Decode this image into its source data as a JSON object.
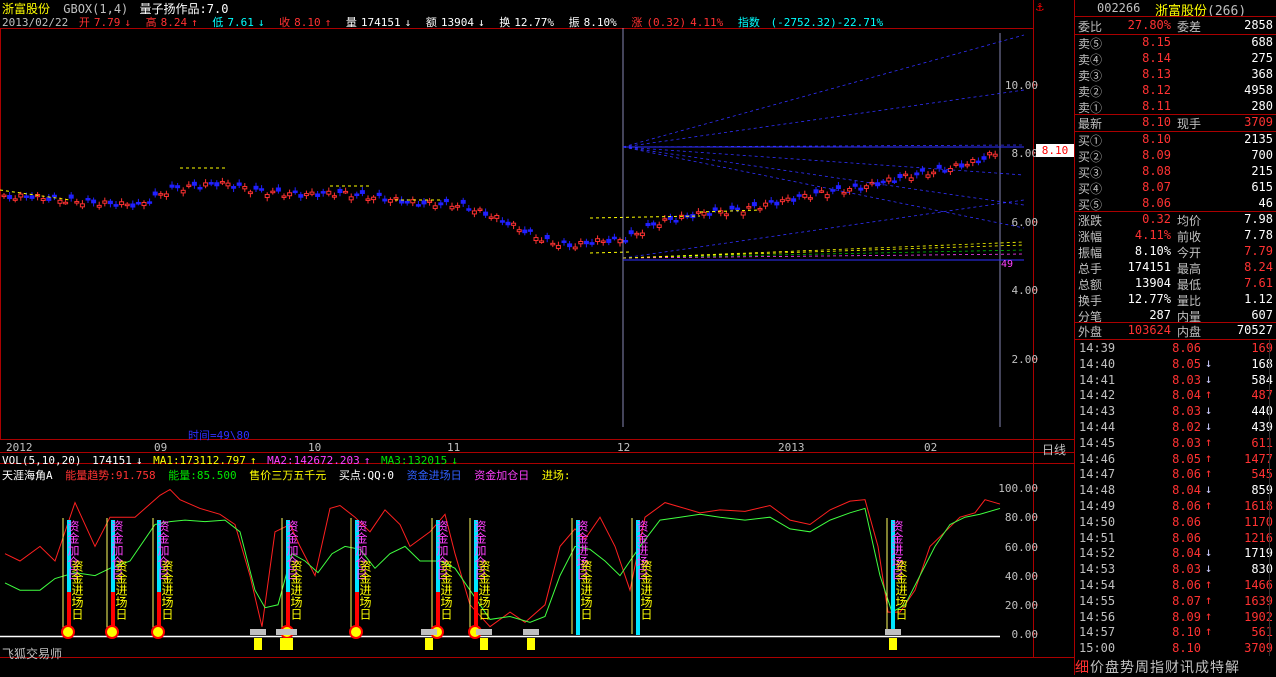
{
  "header": {
    "stock_name": "浙富股份",
    "indicator": "GBOX(1,4)",
    "author": "量子扬作品:7.0"
  },
  "info_bar": {
    "date": "2013/02/22",
    "open_label": "开",
    "open": "7.79",
    "high_label": "高",
    "high": "8.24",
    "low_label": "低",
    "low": "7.61",
    "close_label": "收",
    "close": "8.10",
    "vol_label": "量",
    "vol": "174151",
    "amt_label": "额",
    "amt": "13904",
    "turn_label": "换",
    "turn": "12.77%",
    "amp_label": "振",
    "amp": "8.10%",
    "chg_label": "涨",
    "chg": "(0.32)",
    "chg_pct": "4.11%",
    "index_label": "指数",
    "index": "(-2752.32)-22.71%"
  },
  "price_axis": [
    "10.00",
    "8.00",
    "6.00",
    "4.00",
    "2.00"
  ],
  "current_price_tag": "8.10",
  "time_axis": [
    "2012",
    "09",
    "10",
    "11",
    "12",
    "2013",
    "02"
  ],
  "period_label": "日线",
  "draw_label": "时间=49\\80",
  "candle_count_label": "49",
  "vol_legend": {
    "vol": "VOL(5,10,20)",
    "vol_val": "174151",
    "ma1": "MA1:173112.797",
    "ma2": "MA2:142672.203",
    "ma3": "MA3:132015"
  },
  "ind_legend": {
    "name": "天涯海角A",
    "energy_trend": "能量趋势:91.758",
    "energy": "能量:85.500",
    "sell": "售价三万五千元",
    "buy": "买点:QQ:0",
    "enter": "资金进场日",
    "add": "资金加仓日",
    "in": "进场:"
  },
  "ind_axis": [
    "100.00",
    "80.00",
    "60.00",
    "40.00",
    "20.00",
    "0.00"
  ],
  "watermark": "飞狐交易师",
  "signals": {
    "enter_text": "资金进场日",
    "add_text": "资金加仓日"
  },
  "panel": {
    "code": "002266",
    "name": "浙富股份",
    "count": "(266)",
    "weibi_label": "委比",
    "weibi": "27.80%",
    "weicha_label": "委差",
    "weicha": "2858",
    "sells": [
      {
        "label": "卖⑤",
        "price": "8.15",
        "vol": "688"
      },
      {
        "label": "卖④",
        "price": "8.14",
        "vol": "275"
      },
      {
        "label": "卖③",
        "price": "8.13",
        "vol": "368"
      },
      {
        "label": "卖②",
        "price": "8.12",
        "vol": "4958"
      },
      {
        "label": "卖①",
        "price": "8.11",
        "vol": "280"
      }
    ],
    "latest_label": "最新",
    "latest": "8.10",
    "now_label": "现手",
    "now": "3709",
    "buys": [
      {
        "label": "买①",
        "price": "8.10",
        "vol": "2135"
      },
      {
        "label": "买②",
        "price": "8.09",
        "vol": "700"
      },
      {
        "label": "买③",
        "price": "8.08",
        "vol": "215"
      },
      {
        "label": "买④",
        "price": "8.07",
        "vol": "615"
      },
      {
        "label": "买⑤",
        "price": "8.06",
        "vol": "46"
      }
    ],
    "stats": [
      {
        "l1": "涨跌",
        "v1": "0.32",
        "c1": "red",
        "l2": "均价",
        "v2": "7.98",
        "c2": "wht"
      },
      {
        "l1": "涨幅",
        "v1": "4.11%",
        "c1": "red",
        "l2": "前收",
        "v2": "7.78",
        "c2": "wht"
      },
      {
        "l1": "振幅",
        "v1": "8.10%",
        "c1": "wht",
        "l2": "今开",
        "v2": "7.79",
        "c2": "red"
      },
      {
        "l1": "总手",
        "v1": "174151",
        "c1": "wht",
        "l2": "最高",
        "v2": "8.24",
        "c2": "red"
      },
      {
        "l1": "总额",
        "v1": "13904",
        "c1": "wht",
        "l2": "最低",
        "v2": "7.61",
        "c2": "red"
      },
      {
        "l1": "换手",
        "v1": "12.77%",
        "c1": "wht",
        "l2": "量比",
        "v2": "1.12",
        "c2": "wht"
      },
      {
        "l1": "分笔",
        "v1": "287",
        "c1": "wht",
        "l2": "内量",
        "v2": "607",
        "c2": "wht"
      }
    ],
    "outer_label": "外盘",
    "outer": "103624",
    "inner_label": "内盘",
    "inner": "70527",
    "trades": [
      {
        "t": "14:39",
        "p": "8.06",
        "d": "",
        "v": "169",
        "pc": "red",
        "vc": "red"
      },
      {
        "t": "14:40",
        "p": "8.05",
        "d": "down",
        "v": "168",
        "pc": "red",
        "vc": "wht"
      },
      {
        "t": "14:41",
        "p": "8.03",
        "d": "down",
        "v": "584",
        "pc": "red",
        "vc": "wht"
      },
      {
        "t": "14:42",
        "p": "8.04",
        "d": "up",
        "v": "487",
        "pc": "red",
        "vc": "red"
      },
      {
        "t": "14:43",
        "p": "8.03",
        "d": "down",
        "v": "440",
        "pc": "red",
        "vc": "wht"
      },
      {
        "t": "14:44",
        "p": "8.02",
        "d": "down",
        "v": "439",
        "pc": "red",
        "vc": "wht"
      },
      {
        "t": "14:45",
        "p": "8.03",
        "d": "up",
        "v": "611",
        "pc": "red",
        "vc": "red"
      },
      {
        "t": "14:46",
        "p": "8.05",
        "d": "up",
        "v": "1477",
        "pc": "red",
        "vc": "red"
      },
      {
        "t": "14:47",
        "p": "8.06",
        "d": "up",
        "v": "545",
        "pc": "red",
        "vc": "red"
      },
      {
        "t": "14:48",
        "p": "8.04",
        "d": "down",
        "v": "859",
        "pc": "red",
        "vc": "wht"
      },
      {
        "t": "14:49",
        "p": "8.06",
        "d": "up",
        "v": "1618",
        "pc": "red",
        "vc": "red"
      },
      {
        "t": "14:50",
        "p": "8.06",
        "d": "",
        "v": "1170",
        "pc": "red",
        "vc": "red"
      },
      {
        "t": "14:51",
        "p": "8.06",
        "d": "",
        "v": "1216",
        "pc": "red",
        "vc": "red"
      },
      {
        "t": "14:52",
        "p": "8.04",
        "d": "down",
        "v": "1719",
        "pc": "red",
        "vc": "wht"
      },
      {
        "t": "14:53",
        "p": "8.03",
        "d": "down",
        "v": "830",
        "pc": "red",
        "vc": "wht"
      },
      {
        "t": "14:54",
        "p": "8.06",
        "d": "up",
        "v": "1466",
        "pc": "red",
        "vc": "red"
      },
      {
        "t": "14:55",
        "p": "8.07",
        "d": "up",
        "v": "1639",
        "pc": "red",
        "vc": "red"
      },
      {
        "t": "14:56",
        "p": "8.09",
        "d": "up",
        "v": "1902",
        "pc": "red",
        "vc": "red"
      },
      {
        "t": "14:57",
        "p": "8.10",
        "d": "up",
        "v": "561",
        "pc": "red",
        "vc": "red"
      },
      {
        "t": "15:00",
        "p": "8.10",
        "d": "",
        "v": "3709",
        "pc": "red",
        "vc": "red"
      }
    ],
    "tabs": [
      "细",
      "价",
      "盘",
      "势",
      "周",
      "指",
      "财",
      "讯",
      "成",
      "特",
      "解"
    ]
  },
  "colors": {
    "up": "#ff3232",
    "down": "#00ffff",
    "candle_down": "#2020ff",
    "ma_yellow": "#ffff00",
    "panel_border": "#aa0000",
    "signal_cyan": "#00e5ff",
    "signal_red": "#ff0000",
    "signal_magenta": "#ff40ff"
  }
}
